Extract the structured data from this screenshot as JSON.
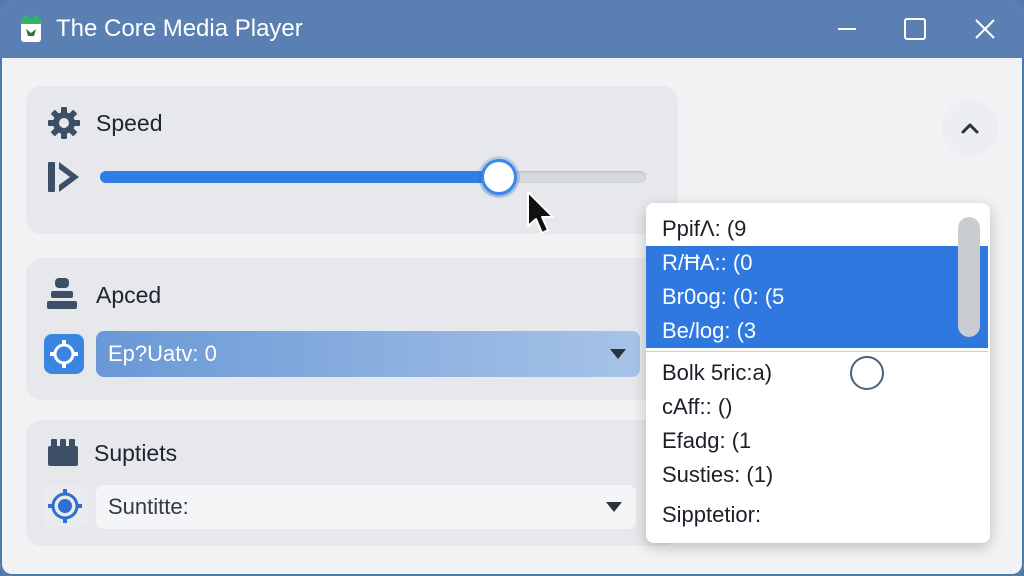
{
  "window": {
    "title": "The Core Media Player"
  },
  "sections": {
    "speed": {
      "title": "Speed",
      "slider_value": 0.73
    },
    "apced": {
      "title": "Apced",
      "dropdown_value": "Ep?Uatv: 0"
    },
    "suptets": {
      "title": "Suptiets",
      "dropdown_value": "Suntitte:"
    }
  },
  "popup": {
    "items": [
      {
        "label": "PpifΛ: (9",
        "selected": false
      },
      {
        "label": "R/ĦA:: (0",
        "selected": true
      },
      {
        "label": "Br0og: (0: (5",
        "selected": true
      },
      {
        "label": "Be/log: (3",
        "selected": true
      },
      {
        "label": "Bolk 5ric:a)",
        "selected": false
      },
      {
        "label": "cAff:: ()",
        "selected": false
      },
      {
        "label": "Efadg: (1",
        "selected": false
      },
      {
        "label": "Susties: (1)",
        "selected": false
      },
      {
        "label": "Sipptetior:",
        "selected": false
      }
    ]
  },
  "colors": {
    "titlebar": "#5a80b3",
    "accent": "#2f7ee6",
    "selection": "#2f78df",
    "panel": "#e6e8eb"
  },
  "icons": {
    "app": "app-logo-icon",
    "speed": "gear-icon",
    "speed_row": "play-forward-icon",
    "apced": "stack-icon",
    "apced_button": "settings-cog-icon",
    "suptets": "captions-icon",
    "suptets_button": "target-icon",
    "collapse": "chevron-up-icon"
  }
}
